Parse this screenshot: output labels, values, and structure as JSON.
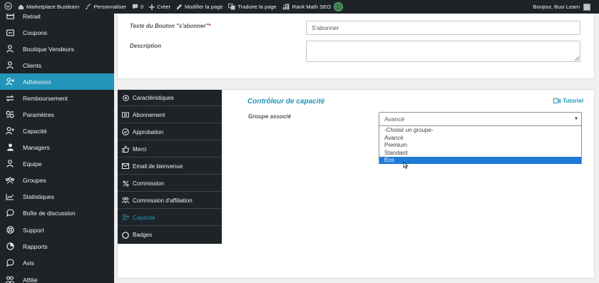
{
  "adminbar": {
    "site_name": "Marketplace Busilearn",
    "customize": "Personnaliser",
    "comments_count": "0",
    "new": "Créer",
    "edit_page": "Modifier la page",
    "translate": "Traduire la page",
    "rank_math": "Rank Math SEO",
    "greeting": "Bonjour, Busi Learn"
  },
  "sidebar": {
    "items": [
      {
        "label": "Retrait",
        "icon": "card-icon"
      },
      {
        "label": "Coupons",
        "icon": "coupon-icon"
      },
      {
        "label": "Boutique Vendeurs",
        "icon": "user-icon"
      },
      {
        "label": "Clients",
        "icon": "user-icon"
      },
      {
        "label": "Adhésions",
        "icon": "user-plus-icon",
        "active": true
      },
      {
        "label": "Remboursement",
        "icon": "refund-icon"
      },
      {
        "label": "Paramètres",
        "icon": "settings-icon"
      },
      {
        "label": "Capacité",
        "icon": "user-plus-icon"
      },
      {
        "label": "Managers",
        "icon": "managers-icon"
      },
      {
        "label": "Equipe",
        "icon": "user-icon"
      },
      {
        "label": "Groupes",
        "icon": "groups-icon"
      },
      {
        "label": "Statistiques",
        "icon": "chart-icon"
      },
      {
        "label": "Boîte de discussion",
        "icon": "chat-icon"
      },
      {
        "label": "Support",
        "icon": "support-icon"
      },
      {
        "label": "Rapports",
        "icon": "pie-icon"
      },
      {
        "label": "Avis",
        "icon": "chat-icon"
      },
      {
        "label": "Affilié",
        "icon": "affiliate-icon"
      }
    ]
  },
  "form": {
    "button_text_label": "Texte du Bouton \"s'abonner\"",
    "required_mark": "*",
    "button_text_value": "S'abonner",
    "description_label": "Description"
  },
  "tabs": [
    {
      "label": "Caractéristiques",
      "icon": "gear-icon"
    },
    {
      "label": "Abonnement",
      "icon": "money-icon"
    },
    {
      "label": "Approbation",
      "icon": "check-circle-icon"
    },
    {
      "label": "Merci",
      "icon": "thumbs-up-icon"
    },
    {
      "label": "Email de bienvenue",
      "icon": "mail-icon"
    },
    {
      "label": "Commission",
      "icon": "percent-icon"
    },
    {
      "label": "Commission d'affiliation",
      "icon": "affiliate-icon"
    },
    {
      "label": "Capacité",
      "icon": "user-plus-icon",
      "current": true
    },
    {
      "label": "Badges",
      "icon": "circle-icon"
    }
  ],
  "capacity": {
    "title": "Contrôleur de capacité",
    "tutorial": "Tutoriel",
    "group_label": "Groupe associé",
    "selected_value": "Avancé",
    "options": [
      "-Choisir un groupe-",
      "Avancé",
      "Premium",
      "Standard",
      "Eco"
    ],
    "highlighted_option": "Eco"
  },
  "colors": {
    "accent": "#2395b8",
    "admin_dark": "#1d2327",
    "option_highlight": "#1e7bd6"
  }
}
